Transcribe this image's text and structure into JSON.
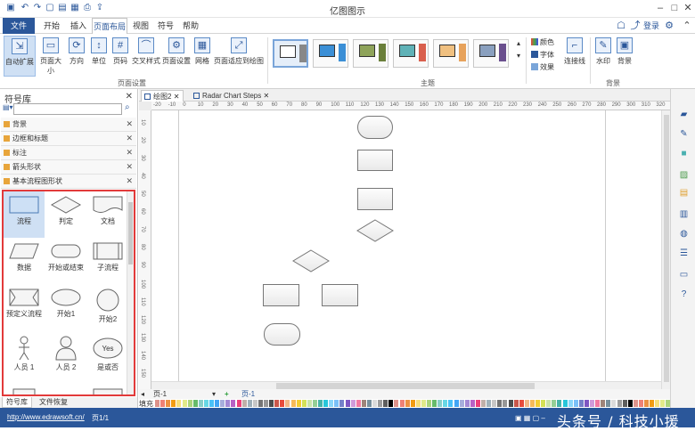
{
  "app": {
    "title": "亿图图示"
  },
  "menu": {
    "file": "文件",
    "tabs": [
      "开始",
      "插入",
      "页面布局",
      "视图",
      "符号",
      "帮助"
    ],
    "login": "登录"
  },
  "ribbon": {
    "buttons": [
      "自动扩展",
      "页面大小",
      "方向",
      "单位",
      "页码",
      "交叉样式",
      "页面设置",
      "网格",
      "页面适应到绘图"
    ],
    "group_page": "页面设置",
    "group_theme": "主题",
    "group_bg": "背景",
    "color_label": "颜色",
    "font_label": "字体",
    "effect_label": "效果",
    "connector_label": "连接线",
    "watermark_label": "水印",
    "background_label": "背景"
  },
  "library": {
    "title": "符号库",
    "search_placeholder": "",
    "categories": [
      "背景",
      "边框和标题",
      "标注",
      "箭头形状",
      "基本流程图形状"
    ],
    "shapes": [
      "流程",
      "判定",
      "文档",
      "数据",
      "开始或结束",
      "子流程",
      "预定义流程",
      "开始1",
      "开始2",
      "人员 1",
      "人员 2",
      "是或否"
    ],
    "yes_no_text": "Yes",
    "bottom_tabs": [
      "符号库",
      "文件恢复"
    ]
  },
  "doc_tabs": [
    "绘图2",
    "Radar Chart Steps"
  ],
  "ruler": {
    "h": [
      "-20",
      "-10",
      "0",
      "10",
      "20",
      "30",
      "40",
      "50",
      "60",
      "70",
      "80",
      "90",
      "100",
      "110",
      "120",
      "130",
      "140",
      "150",
      "160",
      "170",
      "180",
      "190",
      "200",
      "210",
      "220",
      "230",
      "240",
      "250",
      "260",
      "270",
      "280",
      "290",
      "300",
      "310",
      "320"
    ],
    "v": [
      "10",
      "20",
      "30",
      "40",
      "50",
      "60",
      "70",
      "80",
      "90",
      "100",
      "110",
      "120",
      "130",
      "140",
      "150"
    ]
  },
  "pagebar": {
    "page_select": "页-1",
    "page_tab": "页-1",
    "add": "+"
  },
  "palette_label": "填充",
  "colors": {
    "accent": "#2b579a",
    "highlight": "#e23a3a"
  },
  "status": {
    "url": "http://www.edrawsoft.cn/",
    "page": "页1/1",
    "watermark": "头条号 / 科技小援"
  }
}
